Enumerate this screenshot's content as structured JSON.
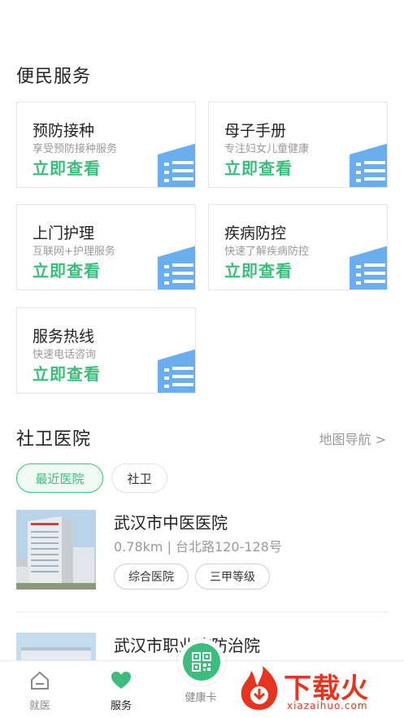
{
  "services": {
    "title": "便民服务",
    "cards": [
      {
        "title": "预防接种",
        "subtitle": "享受预防接种服务",
        "cta": "立即查看"
      },
      {
        "title": "母子手册",
        "subtitle": "专注妇女儿童健康",
        "cta": "立即查看"
      },
      {
        "title": "上门护理",
        "subtitle": "互联网+护理服务",
        "cta": "立即查看"
      },
      {
        "title": "疾病防控",
        "subtitle": "快速了解疾病防控",
        "cta": "立即查看"
      },
      {
        "title": "服务热线",
        "subtitle": "快速电话咨询",
        "cta": "立即查看"
      }
    ]
  },
  "hospitals": {
    "title": "社卫医院",
    "map_link": "地图导航 >",
    "filters": [
      "最近医院",
      "社卫"
    ],
    "list": [
      {
        "name": "武汉市中医医院",
        "address": "0.78km | 台北路120-128号",
        "tags": [
          "综合医院",
          "三甲等级"
        ]
      },
      {
        "name": "武汉市职业病防治院"
      }
    ]
  },
  "tabbar": {
    "items": [
      {
        "label": "就医"
      },
      {
        "label": "服务"
      },
      {
        "label": "健康卡"
      }
    ]
  },
  "watermark": {
    "text": "下载火",
    "sub": "xiazaihuo.com"
  },
  "colors": {
    "accent": "#3dbd7d",
    "watermark": "#e8341f",
    "card_icon": "#6aaef0"
  }
}
